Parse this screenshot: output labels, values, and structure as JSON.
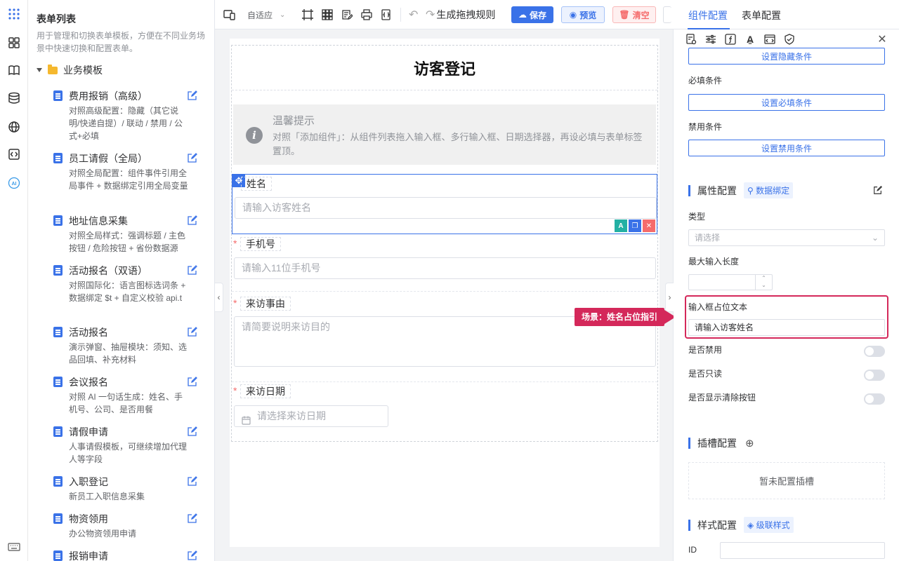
{
  "list_panel": {
    "title": "表单列表",
    "description": "用于管理和切换表单模板，方便在不同业务场景中快速切换和配置表单。",
    "group": "业务模板",
    "items": [
      {
        "name": "费用报销（高级）",
        "desc": "对照高级配置：隐藏（其它说明/快递自提）/ 联动 / 禁用 / 公式+必填"
      },
      {
        "name": "员工请假（全局）",
        "desc": "对照全局配置：组件事件引用全局事件 + 数据绑定引用全局变量"
      },
      {
        "name": "地址信息采集",
        "desc": "对照全局样式：强调标题 / 主色按钮 / 危险按钮 + 省份数据源"
      },
      {
        "name": "活动报名（双语）",
        "desc": "对照国际化：语言图标选词条 + 数据绑定 $t + 自定义校验 api.t"
      },
      {
        "name": "活动报名",
        "desc": "演示弹窗、抽屉模块：须知、选品回填、补充材料"
      },
      {
        "name": "会议报名",
        "desc": "对照 AI 一句话生成：姓名、手机号、公司、是否用餐"
      },
      {
        "name": "请假申请",
        "desc": "人事请假模板，可继续增加代理人等字段"
      },
      {
        "name": "入职登记",
        "desc": "新员工入职信息采集"
      },
      {
        "name": "物资领用",
        "desc": "办公物资领用申请"
      },
      {
        "name": "报销申请",
        "desc": ""
      }
    ]
  },
  "toolbar": {
    "adapt_label": "自适应",
    "rules_label": "生成拖拽规则",
    "save_label": "保存",
    "preview_label": "预览",
    "clear_label": "清空"
  },
  "form": {
    "title": "访客登记",
    "tip_title": "温馨提示",
    "tip_text": "对照「添加组件」：从组件列表拖入输入框、多行输入框、日期选择器，再设必填与表单标签置顶。",
    "fields": [
      {
        "label": "姓名",
        "placeholder": "请输入访客姓名",
        "required": ""
      },
      {
        "label": "手机号",
        "placeholder": "请输入11位手机号",
        "required": "*"
      },
      {
        "label": "来访事由",
        "placeholder": "请简要说明来访目的",
        "required": "*"
      },
      {
        "label": "来访日期",
        "placeholder": "请选择来访日期",
        "required": "*"
      }
    ]
  },
  "callout": "场景：姓名占位指引",
  "right_panel": {
    "tabs": [
      "组件配置",
      "表单配置"
    ],
    "hidden_btn": "设置隐藏条件",
    "required_label": "必填条件",
    "required_btn": "设置必填条件",
    "disabled_label": "禁用条件",
    "disabled_btn": "设置禁用条件",
    "attr_title": "属性配置",
    "attr_tag": "数据绑定",
    "type_label": "类型",
    "type_placeholder": "请选择",
    "maxlen_label": "最大输入长度",
    "placeholder_label": "输入框占位文本",
    "placeholder_value": "请输入访客姓名",
    "disable_label": "是否禁用",
    "readonly_label": "是否只读",
    "clear_label": "是否显示清除按钮",
    "slot_title": "插槽配置",
    "slot_empty": "暂未配置插槽",
    "style_title": "样式配置",
    "style_tag": "级联样式",
    "id_label": "ID"
  },
  "colors": {
    "primary": "#3a72e8",
    "danger": "#f56c6c",
    "highlight": "#d4285a"
  }
}
